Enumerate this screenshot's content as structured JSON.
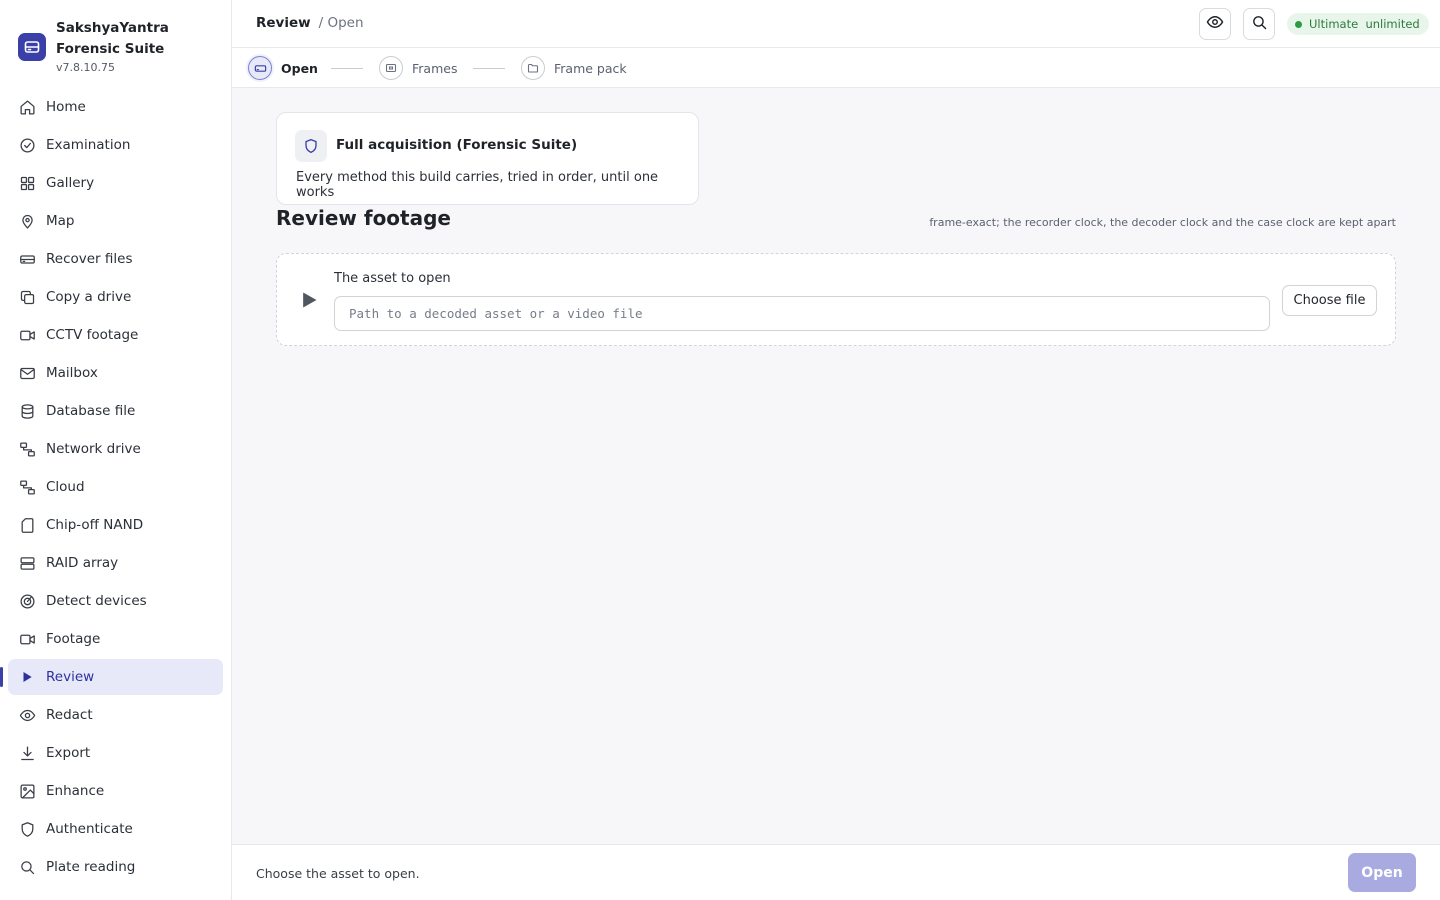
{
  "app": {
    "name": "SakshyaYantra Forensic Suite",
    "version": "v7.8.10.75"
  },
  "sidebar": {
    "items": [
      {
        "label": "Home",
        "icon": "home-icon"
      },
      {
        "label": "Examination",
        "icon": "check-circle-icon"
      },
      {
        "label": "Gallery",
        "icon": "grid-icon"
      },
      {
        "label": "Map",
        "icon": "map-pin-icon"
      },
      {
        "label": "Recover files",
        "icon": "drive-icon"
      },
      {
        "label": "Copy a drive",
        "icon": "copy-icon"
      },
      {
        "label": "CCTV footage",
        "icon": "video-camera-icon"
      },
      {
        "label": "Mailbox",
        "icon": "mail-icon"
      },
      {
        "label": "Database file",
        "icon": "database-icon"
      },
      {
        "label": "Network drive",
        "icon": "network-icon"
      },
      {
        "label": "Cloud",
        "icon": "network-icon"
      },
      {
        "label": "Chip-off NAND",
        "icon": "file-icon"
      },
      {
        "label": "RAID array",
        "icon": "server-icon"
      },
      {
        "label": "Detect devices",
        "icon": "radar-icon"
      },
      {
        "label": "Footage",
        "icon": "video-camera-icon"
      },
      {
        "label": "Review",
        "icon": "play-icon",
        "active": true
      },
      {
        "label": "Redact",
        "icon": "eye-icon"
      },
      {
        "label": "Export",
        "icon": "download-icon"
      },
      {
        "label": "Enhance",
        "icon": "image-icon"
      },
      {
        "label": "Authenticate",
        "icon": "shield-icon"
      },
      {
        "label": "Plate reading",
        "icon": "search-icon"
      }
    ]
  },
  "header": {
    "breadcrumb_current": "Review",
    "breadcrumb_sub": "/ Open",
    "license_badge": "Ultimate  unlimited"
  },
  "steps": [
    {
      "label": "Open",
      "icon": "drive-icon",
      "current": true
    },
    {
      "label": "Frames",
      "icon": "frame-icon",
      "current": false
    },
    {
      "label": "Frame pack",
      "icon": "folder-icon",
      "current": false
    }
  ],
  "method": {
    "title": "Full acquisition (Forensic Suite)",
    "description": "Every method this build carries, tried in order, until one works"
  },
  "page": {
    "title": "Review footage",
    "note": "frame-exact; the recorder clock, the decoder clock and the case clock are kept apart"
  },
  "asset": {
    "label": "The asset to open",
    "placeholder": "Path to a decoded asset or a video file",
    "value": "",
    "choose_button": "Choose file"
  },
  "footer": {
    "message": "Choose the asset to open.",
    "open_button": "Open"
  },
  "colors": {
    "accent": "#3b3fa8",
    "active_bg": "#e8e9f8",
    "badge_bg": "#e8f5ea",
    "badge_text": "#2f7a3a",
    "open_disabled": "#a9abe0"
  }
}
